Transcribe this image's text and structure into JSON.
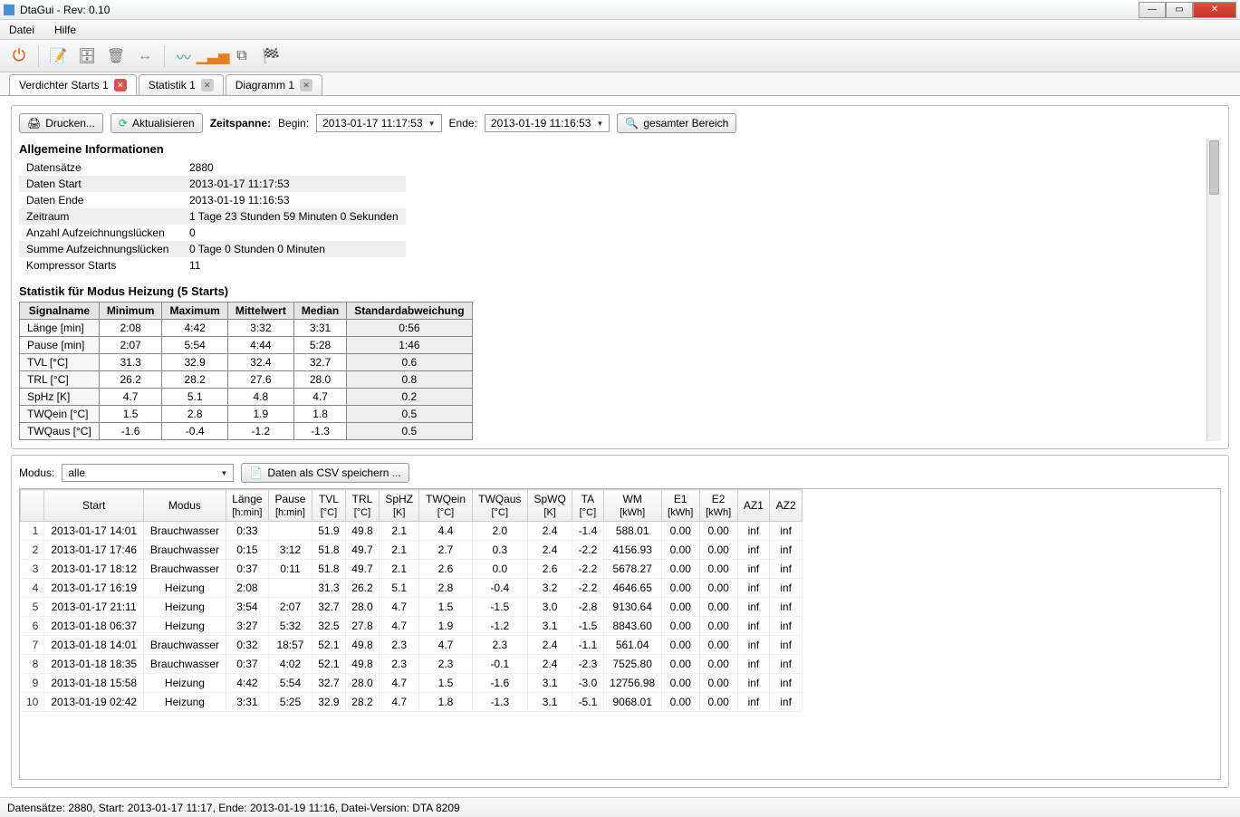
{
  "window": {
    "title": "DtaGui - Rev: 0.10"
  },
  "menu": {
    "file": "Datei",
    "help": "Hilfe"
  },
  "tabs": [
    {
      "label": "Verdichter Starts 1",
      "close_style": "red",
      "active": true
    },
    {
      "label": "Statistik 1",
      "close_style": "grey"
    },
    {
      "label": "Diagramm 1",
      "close_style": "grey"
    }
  ],
  "controls": {
    "print": "Drucken...",
    "refresh": "Aktualisieren",
    "timespan_label": "Zeitspanne:",
    "begin_label": "Begin:",
    "begin_value": "2013-01-17 11:17:53",
    "end_label": "Ende:",
    "end_value": "2013-01-19 11:16:53",
    "full_range": "gesamter Bereich"
  },
  "info_heading": "Allgemeine Informationen",
  "info_rows": [
    {
      "k": "Datensätze",
      "v": "2880"
    },
    {
      "k": "Daten Start",
      "v": "2013-01-17 11:17:53"
    },
    {
      "k": "Daten Ende",
      "v": "2013-01-19 11:16:53"
    },
    {
      "k": "Zeitraum",
      "v": "1 Tage 23 Stunden 59 Minuten 0 Sekunden"
    },
    {
      "k": "Anzahl Aufzeichnungslücken",
      "v": "0"
    },
    {
      "k": "Summe Aufzeichnungslücken",
      "v": "0 Tage 0 Stunden 0 Minuten"
    },
    {
      "k": "Kompressor Starts",
      "v": "11"
    }
  ],
  "stats_heading": "Statistik für Modus Heizung (5 Starts)",
  "stats_cols": [
    "Signalname",
    "Minimum",
    "Maximum",
    "Mittelwert",
    "Median",
    "Standardabweichung"
  ],
  "stats_rows": [
    [
      "Länge [min]",
      "2:08",
      "4:42",
      "3:32",
      "3:31",
      "0:56"
    ],
    [
      "Pause [min]",
      "2:07",
      "5:54",
      "4:44",
      "5:28",
      "1:46"
    ],
    [
      "TVL [°C]",
      "31.3",
      "32.9",
      "32.4",
      "32.7",
      "0.6"
    ],
    [
      "TRL [°C]",
      "26.2",
      "28.2",
      "27.6",
      "28.0",
      "0.8"
    ],
    [
      "SpHz [K]",
      "4.7",
      "5.1",
      "4.8",
      "4.7",
      "0.2"
    ],
    [
      "TWQein [°C]",
      "1.5",
      "2.8",
      "1.9",
      "1.8",
      "0.5"
    ],
    [
      "TWQaus [°C]",
      "-1.6",
      "-0.4",
      "-1.2",
      "-1.3",
      "0.5"
    ]
  ],
  "bottom": {
    "modus_label": "Modus:",
    "modus_value": "alle",
    "csv_button": "Daten als CSV speichern ..."
  },
  "grid_cols": [
    {
      "t": "",
      "s": ""
    },
    {
      "t": "Start",
      "s": ""
    },
    {
      "t": "Modus",
      "s": ""
    },
    {
      "t": "Länge",
      "s": "[h:min]"
    },
    {
      "t": "Pause",
      "s": "[h:min]"
    },
    {
      "t": "TVL",
      "s": "[°C]"
    },
    {
      "t": "TRL",
      "s": "[°C]"
    },
    {
      "t": "SpHZ",
      "s": "[K]"
    },
    {
      "t": "TWQein",
      "s": "[°C]"
    },
    {
      "t": "TWQaus",
      "s": "[°C]"
    },
    {
      "t": "SpWQ",
      "s": "[K]"
    },
    {
      "t": "TA",
      "s": "[°C]"
    },
    {
      "t": "WM",
      "s": "[kWh]"
    },
    {
      "t": "E1",
      "s": "[kWh]"
    },
    {
      "t": "E2",
      "s": "[kWh]"
    },
    {
      "t": "AZ1",
      "s": ""
    },
    {
      "t": "AZ2",
      "s": ""
    }
  ],
  "grid_rows": [
    [
      "1",
      "2013-01-17 14:01",
      "Brauchwasser",
      "0:33",
      "",
      "51.9",
      "49.8",
      "2.1",
      "4.4",
      "2.0",
      "2.4",
      "-1.4",
      "588.01",
      "0.00",
      "0.00",
      "inf",
      "inf"
    ],
    [
      "2",
      "2013-01-17 17:46",
      "Brauchwasser",
      "0:15",
      "3:12",
      "51.8",
      "49.7",
      "2.1",
      "2.7",
      "0.3",
      "2.4",
      "-2.2",
      "4156.93",
      "0.00",
      "0.00",
      "inf",
      "inf"
    ],
    [
      "3",
      "2013-01-17 18:12",
      "Brauchwasser",
      "0:37",
      "0:11",
      "51.8",
      "49.7",
      "2.1",
      "2.6",
      "0.0",
      "2.6",
      "-2.2",
      "5678.27",
      "0.00",
      "0.00",
      "inf",
      "inf"
    ],
    [
      "4",
      "2013-01-17 16:19",
      "Heizung",
      "2:08",
      "",
      "31.3",
      "26.2",
      "5.1",
      "2.8",
      "-0.4",
      "3.2",
      "-2.2",
      "4646.65",
      "0.00",
      "0.00",
      "inf",
      "inf"
    ],
    [
      "5",
      "2013-01-17 21:11",
      "Heizung",
      "3:54",
      "2:07",
      "32.7",
      "28.0",
      "4.7",
      "1.5",
      "-1.5",
      "3.0",
      "-2.8",
      "9130.64",
      "0.00",
      "0.00",
      "inf",
      "inf"
    ],
    [
      "6",
      "2013-01-18 06:37",
      "Heizung",
      "3:27",
      "5:32",
      "32.5",
      "27.8",
      "4.7",
      "1.9",
      "-1.2",
      "3.1",
      "-1.5",
      "8843.60",
      "0.00",
      "0.00",
      "inf",
      "inf"
    ],
    [
      "7",
      "2013-01-18 14:01",
      "Brauchwasser",
      "0:32",
      "18:57",
      "52.1",
      "49.8",
      "2.3",
      "4.7",
      "2.3",
      "2.4",
      "-1.1",
      "561.04",
      "0.00",
      "0.00",
      "inf",
      "inf"
    ],
    [
      "8",
      "2013-01-18 18:35",
      "Brauchwasser",
      "0:37",
      "4:02",
      "52.1",
      "49.8",
      "2.3",
      "2.3",
      "-0.1",
      "2.4",
      "-2.3",
      "7525.80",
      "0.00",
      "0.00",
      "inf",
      "inf"
    ],
    [
      "9",
      "2013-01-18 15:58",
      "Heizung",
      "4:42",
      "5:54",
      "32.7",
      "28.0",
      "4.7",
      "1.5",
      "-1.6",
      "3.1",
      "-3.0",
      "12756.98",
      "0.00",
      "0.00",
      "inf",
      "inf"
    ],
    [
      "10",
      "2013-01-19 02:42",
      "Heizung",
      "3:31",
      "5:25",
      "32.9",
      "28.2",
      "4.7",
      "1.8",
      "-1.3",
      "3.1",
      "-5.1",
      "9068.01",
      "0.00",
      "0.00",
      "inf",
      "inf"
    ]
  ],
  "status": "Datensätze: 2880, Start: 2013-01-17 11:17, Ende: 2013-01-19 11:16, Datei-Version: DTA 8209"
}
